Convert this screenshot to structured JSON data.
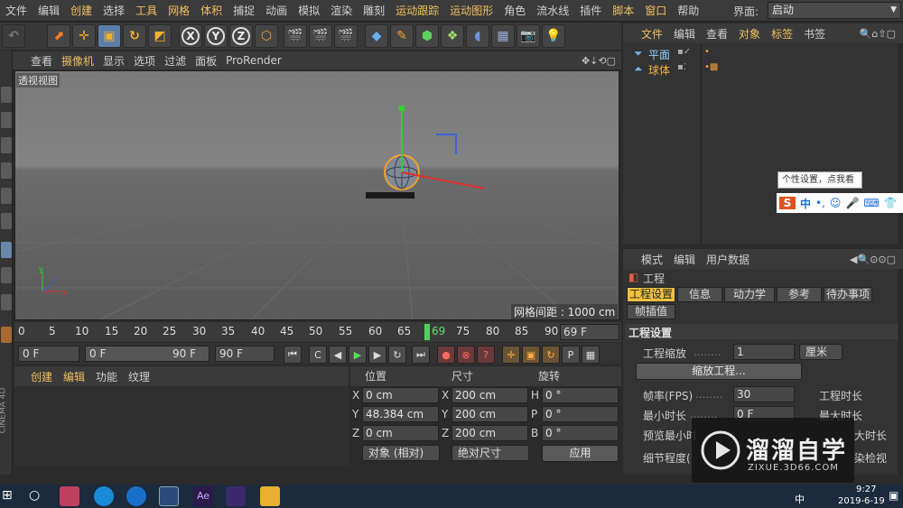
{
  "menubar": {
    "items": [
      "文件",
      "编辑",
      "创建",
      "选择",
      "工具",
      "网格",
      "体积",
      "捕捉",
      "动画",
      "模拟",
      "渲染",
      "雕刻",
      "运动跟踪",
      "运动图形",
      "角色",
      "流水线",
      "插件",
      "脚本",
      "窗口",
      "帮助"
    ],
    "layout_label": "界面:",
    "layout_value": "启动"
  },
  "toolbar": {
    "axis_x": "X",
    "axis_y": "Y",
    "axis_z": "Z"
  },
  "viewport": {
    "menu": [
      "查看",
      "摄像机",
      "显示",
      "选项",
      "过滤",
      "面板",
      "ProRender"
    ],
    "name": "透视视图",
    "grid_info": "网格间距 : 1000 cm"
  },
  "timeline": {
    "ticks": [
      "0",
      "5",
      "10",
      "15",
      "20",
      "25",
      "30",
      "35",
      "40",
      "45",
      "50",
      "55",
      "60",
      "65",
      "69",
      "75",
      "80",
      "85",
      "90"
    ],
    "current_frame": "69 F",
    "start": "0 F",
    "range_start": "0 F",
    "range_end": "90 F",
    "end": "90 F"
  },
  "material": {
    "menu": [
      "创建",
      "编辑",
      "功能",
      "纹理"
    ]
  },
  "coordinates": {
    "headers": [
      "位置",
      "尺寸",
      "旋转"
    ],
    "rows": [
      {
        "pos_axis": "X",
        "pos": "0 cm",
        "size_axis": "X",
        "size": "200 cm",
        "rot_axis": "H",
        "rot": "0 °"
      },
      {
        "pos_axis": "Y",
        "pos": "48.384 cm",
        "size_axis": "Y",
        "size": "200 cm",
        "rot_axis": "P",
        "rot": "0 °"
      },
      {
        "pos_axis": "Z",
        "pos": "0 cm",
        "size_axis": "Z",
        "size": "200 cm",
        "rot_axis": "B",
        "rot": "0 °"
      }
    ],
    "mode": "对象 (相对)",
    "size_mode": "绝对尺寸",
    "apply": "应用"
  },
  "objects": {
    "menu": [
      "文件",
      "编辑",
      "查看",
      "对象",
      "标签",
      "书签"
    ],
    "items": [
      "平面",
      "球体"
    ]
  },
  "attributes": {
    "menu": [
      "模式",
      "编辑",
      "用户数据"
    ],
    "title": "工程",
    "tabs": [
      "工程设置",
      "信息",
      "动力学",
      "参考",
      "待办事项",
      "帧插值"
    ],
    "section": "工程设置",
    "scale_label": "工程缩放",
    "scale_value": "1",
    "scale_unit": "厘米",
    "scale_button": "缩放工程...",
    "fps_label": "帧率(FPS)",
    "fps_value": "30",
    "project_time_label": "工程时长",
    "min_time_label": "最小时长",
    "min_time_value": "0 F",
    "max_time_label": "最大时长",
    "preview_min_label": "预览最小时",
    "preview_max_label": "大时长",
    "detail_label": "细节程度(",
    "render_check_label": "染检视"
  },
  "ime": {
    "tip": "个性设置，点我看看",
    "lang": "中"
  },
  "watermark": {
    "brand": "溜溜自学",
    "url": "ZIXUE.3D66.COM"
  },
  "taskbar": {
    "time": "9:27",
    "date": "2019-6-19",
    "lang": "中"
  },
  "colors": {
    "accent": "#f0c040",
    "highlight_menu": "#f0c060",
    "object_text": "#8fd0ff"
  }
}
